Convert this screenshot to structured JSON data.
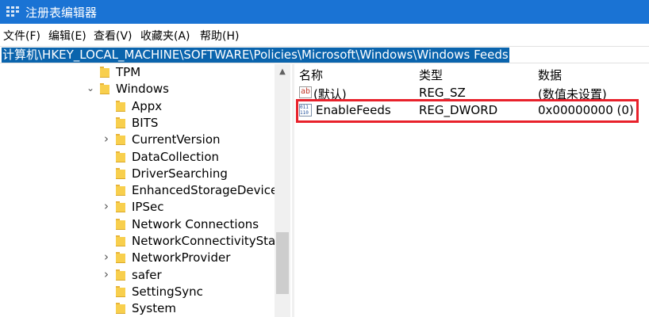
{
  "window": {
    "title": "注册表编辑器"
  },
  "menu": [
    "文件(F)",
    "编辑(E)",
    "查看(V)",
    "收藏夹(A)",
    "帮助(H)"
  ],
  "address": {
    "path": "计算机\\HKEY_LOCAL_MACHINE\\SOFTWARE\\Policies\\Microsoft\\Windows\\Windows Feeds"
  },
  "tree": [
    {
      "label": "TPM",
      "level": 0,
      "expander": "none"
    },
    {
      "label": "Windows",
      "level": 0,
      "expander": "expanded"
    },
    {
      "label": "Appx",
      "level": 1,
      "expander": "none"
    },
    {
      "label": "BITS",
      "level": 1,
      "expander": "none"
    },
    {
      "label": "CurrentVersion",
      "level": 1,
      "expander": "collapsed"
    },
    {
      "label": "DataCollection",
      "level": 1,
      "expander": "none"
    },
    {
      "label": "DriverSearching",
      "level": 1,
      "expander": "none"
    },
    {
      "label": "EnhancedStorageDevices",
      "level": 1,
      "expander": "none"
    },
    {
      "label": "IPSec",
      "level": 1,
      "expander": "collapsed"
    },
    {
      "label": "Network Connections",
      "level": 1,
      "expander": "none"
    },
    {
      "label": "NetworkConnectivityStat",
      "level": 1,
      "expander": "none"
    },
    {
      "label": "NetworkProvider",
      "level": 1,
      "expander": "collapsed"
    },
    {
      "label": "safer",
      "level": 1,
      "expander": "collapsed"
    },
    {
      "label": "SettingSync",
      "level": 1,
      "expander": "none"
    },
    {
      "label": "System",
      "level": 1,
      "expander": "none"
    }
  ],
  "values": {
    "headers": {
      "name": "名称",
      "type": "类型",
      "data": "数据"
    },
    "rows": [
      {
        "icon": "string-value-icon",
        "icon_text": "ab",
        "name": "(默认)",
        "type": "REG_SZ",
        "data": "(数值未设置)"
      },
      {
        "icon": "binary-value-icon",
        "icon_text": "011 110",
        "name": "EnableFeeds",
        "type": "REG_DWORD",
        "data": "0x00000000 (0)"
      }
    ]
  },
  "colors": {
    "titlebar": "#1a73d4",
    "selection": "#0a64ad",
    "highlight_box": "#e8212b",
    "folder": "#f8cf4d"
  }
}
